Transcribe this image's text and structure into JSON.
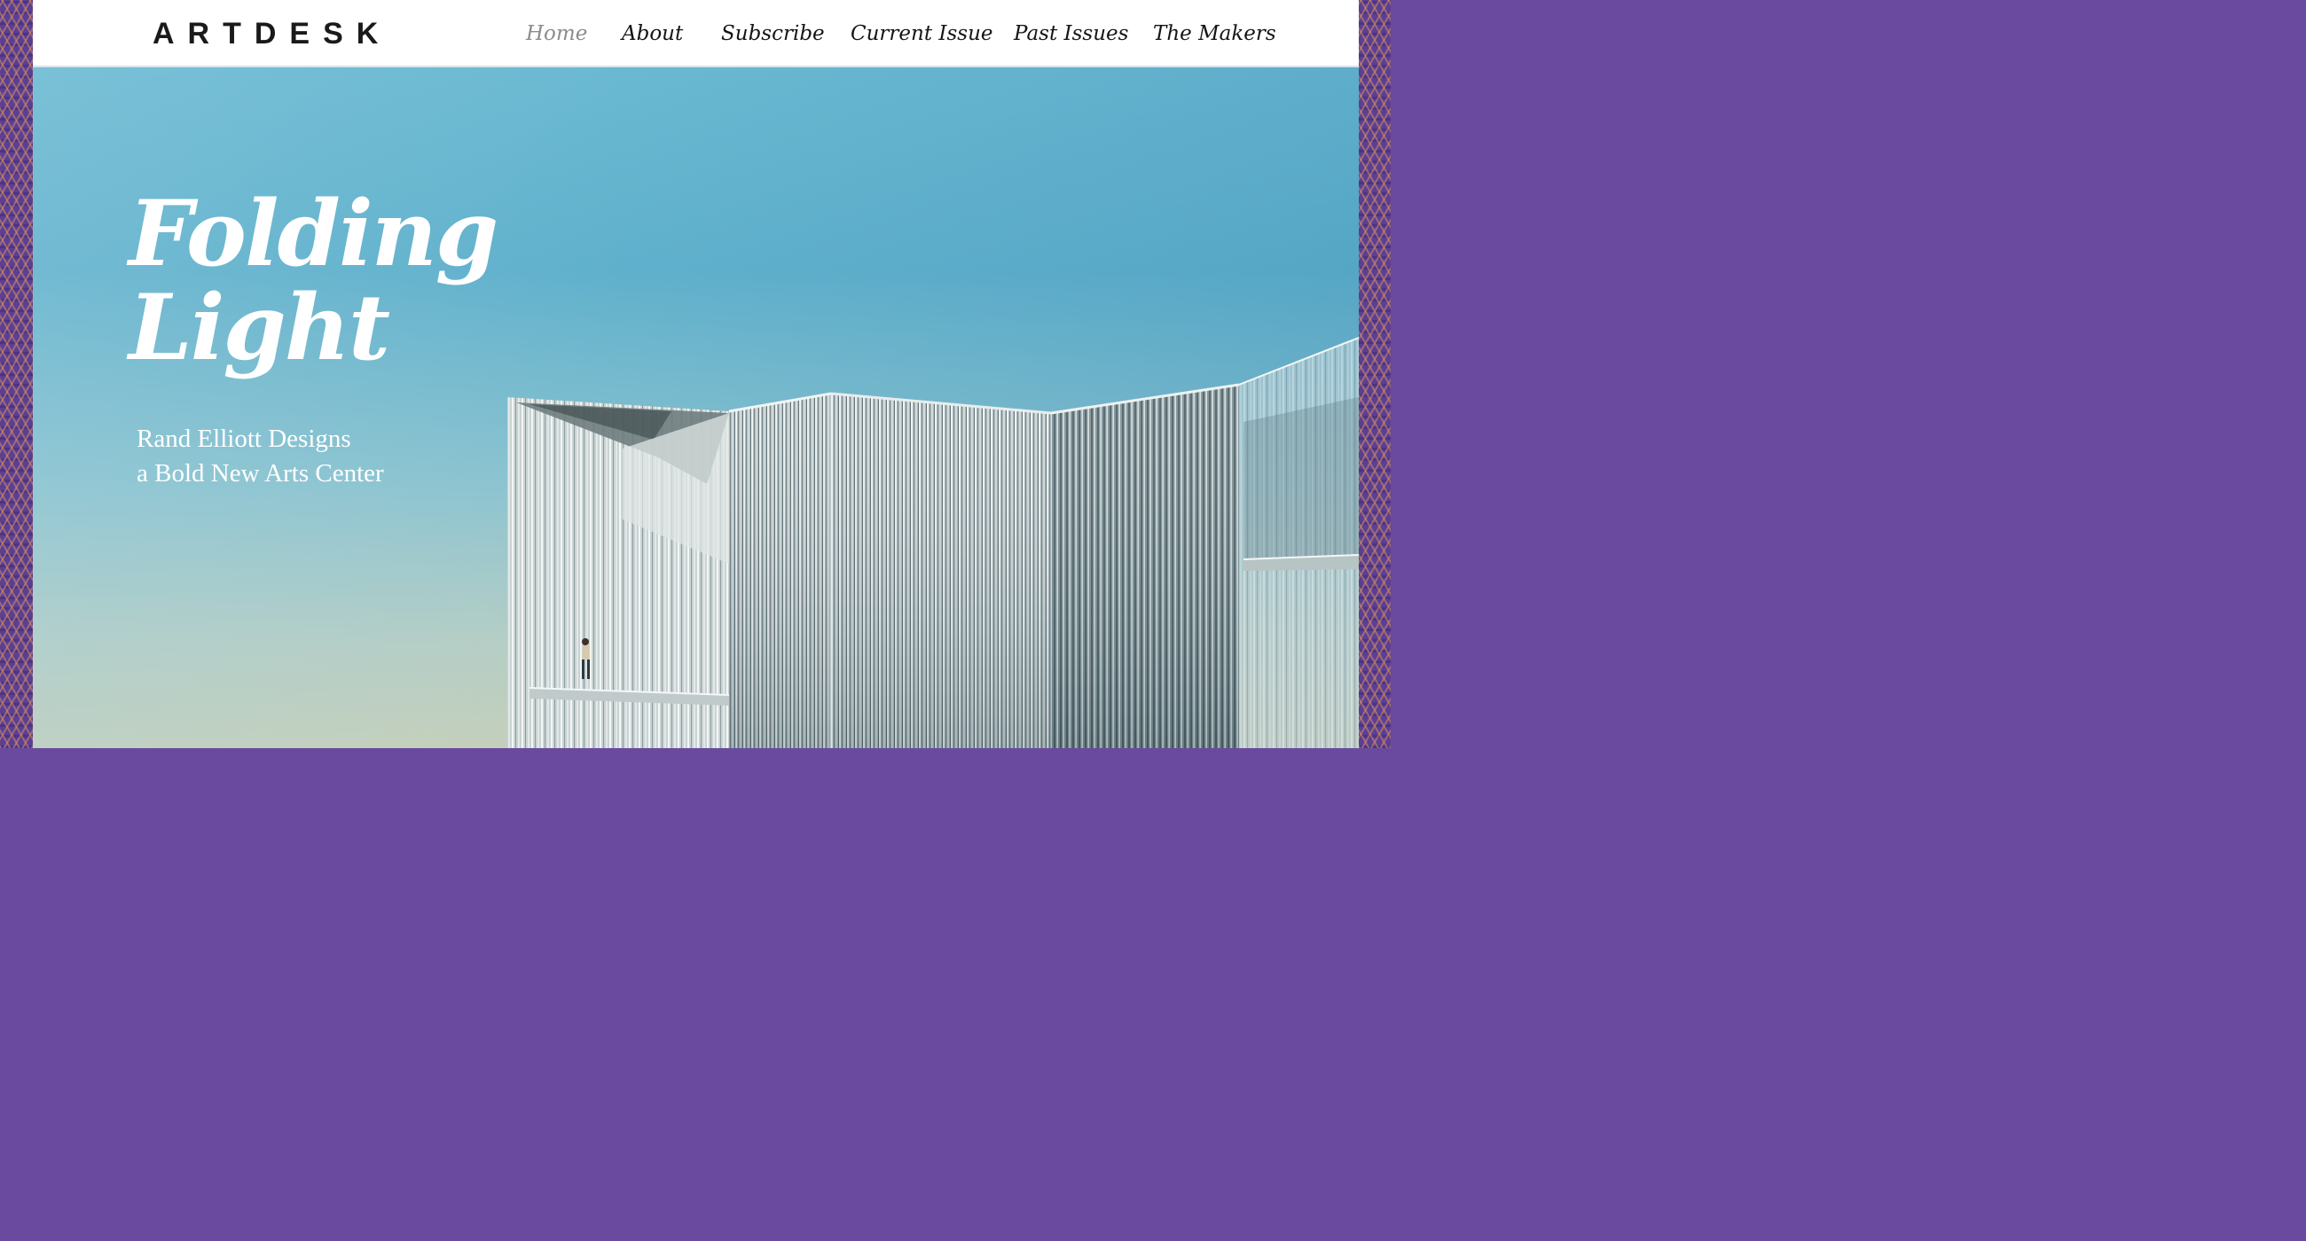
{
  "site": {
    "logo": "ARTDESK"
  },
  "nav": {
    "items": [
      {
        "label": "Home",
        "active": true
      },
      {
        "label": "About",
        "active": false
      },
      {
        "label": "Subscribe",
        "active": false
      },
      {
        "label": "Current Issue",
        "active": false
      },
      {
        "label": "Past Issues",
        "active": false
      },
      {
        "label": "The Makers",
        "active": false
      }
    ]
  },
  "hero": {
    "title_line1": "Folding",
    "title_line2": "Light",
    "subtitle_line1": "Rand Elliott Designs",
    "subtitle_line2": "a Bold New Arts Center",
    "image": "building-photo"
  },
  "colors": {
    "sky_top": "#6ab9d2",
    "sky_bottom": "#c6cfb9",
    "border_purple": "#5b3f95",
    "nav_text": "#151515",
    "nav_active": "#8c8c8c"
  }
}
